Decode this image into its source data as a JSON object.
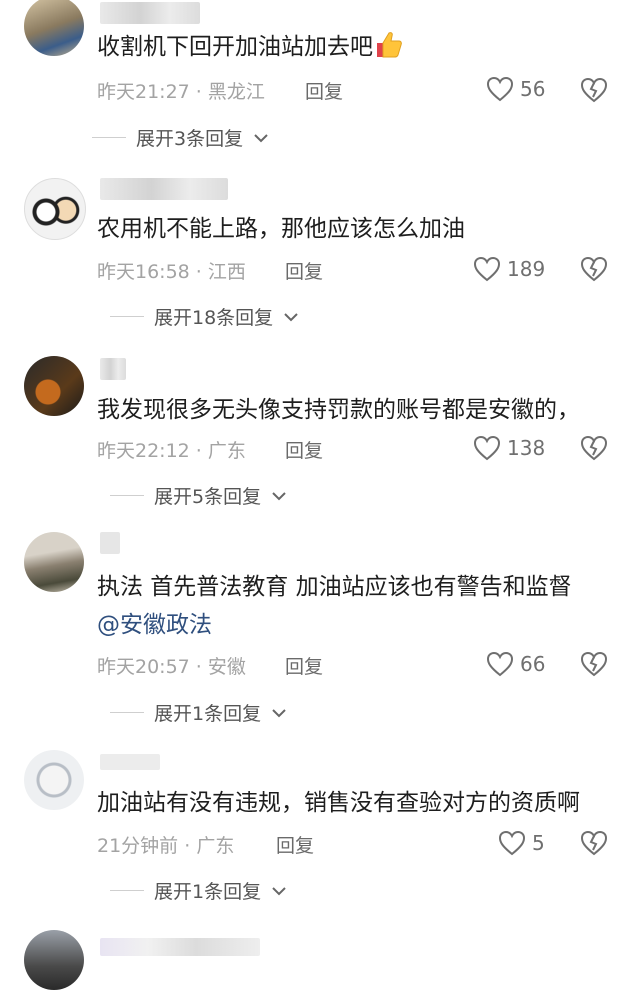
{
  "comments": [
    {
      "text": "收割机下回开加油站加去吧",
      "emoji": "thumbs-up-icon",
      "time": "昨天21:27",
      "location": "黑龙江",
      "reply": "回复",
      "likes": "56",
      "expand": "展开3条回复"
    },
    {
      "text": "农用机不能上路，那他应该怎么加油",
      "time": "昨天16:58",
      "location": "江西",
      "reply": "回复",
      "likes": "189",
      "expand": "展开18条回复"
    },
    {
      "text": "我发现很多无头像支持罚款的账号都是安徽的，",
      "time": "昨天22:12",
      "location": "广东",
      "reply": "回复",
      "likes": "138",
      "expand": "展开5条回复"
    },
    {
      "text": "执法 首先普法教育 加油站应该也有警告和监督",
      "mention": "@安徽政法",
      "time": "昨天20:57",
      "location": "安徽",
      "reply": "回复",
      "likes": "66",
      "expand": "展开1条回复"
    },
    {
      "text": "加油站有没有违规，销售没有查验对方的资质啊",
      "time": "21分钟前",
      "location": "广东",
      "reply": "回复",
      "likes": "5",
      "expand": "展开1条回复"
    }
  ],
  "separator": " · ",
  "colors": {
    "text": "#1e1e1e",
    "meta": "#a3a3a3",
    "mention": "#2f4f7e",
    "heart": "#6f6f6f"
  }
}
